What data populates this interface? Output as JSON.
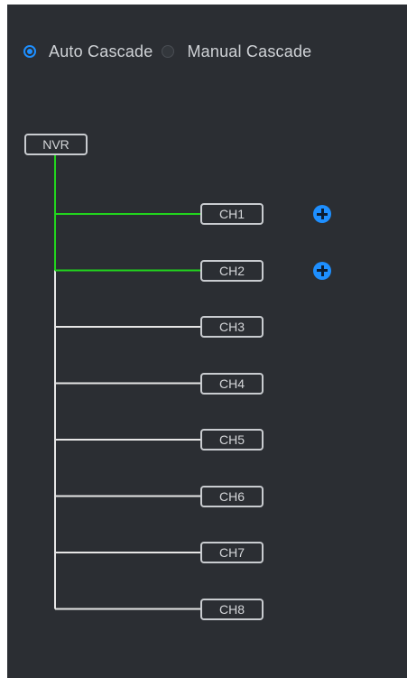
{
  "cascade_mode": {
    "options": [
      {
        "label": "Auto Cascade",
        "selected": true
      },
      {
        "label": "Manual Cascade",
        "selected": false
      }
    ]
  },
  "tree": {
    "root": {
      "label": "NVR"
    },
    "channels": [
      {
        "label": "CH1",
        "connected": true,
        "add_icon": "plus-circle-icon"
      },
      {
        "label": "CH2",
        "connected": true,
        "add_icon": "plus-circle-icon"
      },
      {
        "label": "CH3",
        "connected": false
      },
      {
        "label": "CH4",
        "connected": false
      },
      {
        "label": "CH5",
        "connected": false
      },
      {
        "label": "CH6",
        "connected": false
      },
      {
        "label": "CH7",
        "connected": false
      },
      {
        "label": "CH8",
        "connected": false
      }
    ]
  },
  "colors": {
    "connected_line": "#22d41e",
    "idle_line": "#e6e6e6",
    "accent": "#1e8fff",
    "panel_bg": "#2b2e33"
  }
}
